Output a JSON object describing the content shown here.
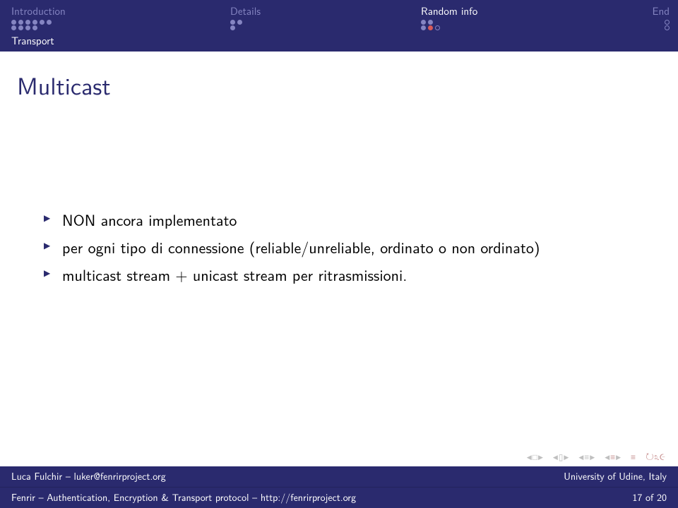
{
  "nav": {
    "sections": {
      "introduction": {
        "label": "Introduction",
        "active": false,
        "rows": [
          6,
          4
        ]
      },
      "details": {
        "label": "Details",
        "active": false,
        "rows": [
          2,
          1
        ]
      },
      "random": {
        "label": "Random info",
        "active": true,
        "rows": [
          2,
          3
        ],
        "current": [
          1,
          1
        ]
      },
      "end": {
        "label": "End",
        "active": false,
        "rows": [
          1,
          1
        ]
      }
    },
    "subsection": "Transport"
  },
  "slide": {
    "title": "Multicast",
    "bullets": [
      "NON ancora implementato",
      "per ogni tipo di connessione (reliable/unreliable, ordinato o non ordinato)",
      "multicast stream + unicast stream per ritrasmissioni."
    ]
  },
  "footer": {
    "author_line": "Luca Fulchir – luker@fenrirproject.org",
    "affiliation": "University of Udine, Italy",
    "talk_title": "Fenrir – Authentication, Encryption & Transport protocol – http://fenrirproject.org",
    "page": "17 of 20"
  }
}
